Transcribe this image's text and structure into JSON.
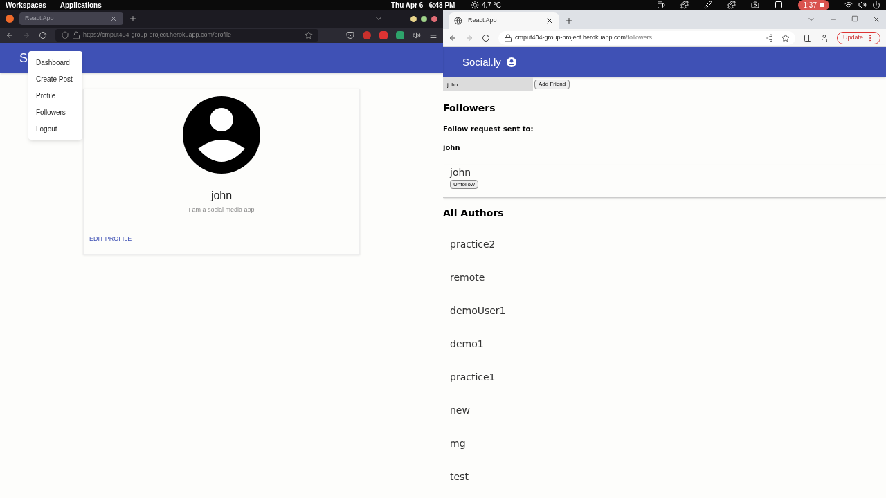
{
  "top_bar": {
    "workspaces": "Workspaces",
    "applications": "Applications",
    "clock": "Thu Apr 6   6:48 PM",
    "weather": "4.7 °C",
    "recording": "1:37"
  },
  "left_browser": {
    "tab": {
      "title": "React App"
    },
    "url": "https://cmput404-group-project.herokuapp.com/profile",
    "page": {
      "brand": "S",
      "menu": [
        "Dashboard",
        "Create Post",
        "Profile",
        "Followers",
        "Logout"
      ],
      "profile": {
        "name": "john",
        "bio": "I am a social media app",
        "edit": "EDIT PROFILE"
      }
    }
  },
  "right_browser": {
    "tab": {
      "title": "React App"
    },
    "url_host": "cmput404-group-project.herokuapp.com",
    "url_path": "/followers",
    "update": "Update",
    "page": {
      "brand": "Social.ly",
      "friend_input": {
        "value": "john"
      },
      "add_button": "Add Friend",
      "heading": "Followers",
      "request_label": "Follow request sent to:",
      "request_name": "john",
      "followers": [
        {
          "name": "john",
          "button": "Unfollow"
        }
      ],
      "authors_heading": "All Authors",
      "authors": [
        "practice2",
        "remote",
        "demoUser1",
        "demo1",
        "practice1",
        "new",
        "mg",
        "test"
      ]
    }
  }
}
